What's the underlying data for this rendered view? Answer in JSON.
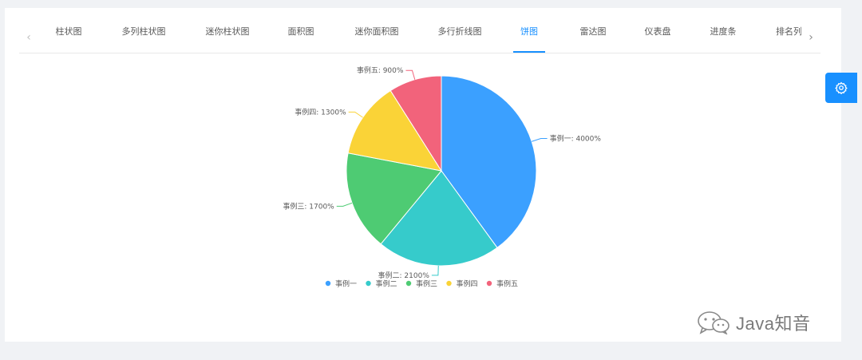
{
  "tabs": {
    "items": [
      "柱状图",
      "多列柱状图",
      "迷你柱状图",
      "面积图",
      "迷你面积图",
      "多行折线图",
      "饼图",
      "雷达图",
      "仪表盘",
      "进度条",
      "排名列"
    ],
    "active_index": 6
  },
  "settings": {
    "icon": "gear-icon"
  },
  "watermark": {
    "text": "Java知音",
    "icon": "wechat-icon"
  },
  "colors": {
    "accent": "#1890ff",
    "series": [
      "#3ba0ff",
      "#36cbcb",
      "#4ecb73",
      "#fad337",
      "#f2637b"
    ]
  },
  "chart_data": {
    "type": "pie",
    "labels": [
      "事例一",
      "事例二",
      "事例三",
      "事例四",
      "事例五"
    ],
    "values": [
      4000,
      2100,
      1700,
      1300,
      900
    ],
    "slice_labels": [
      "事例一: 4000%",
      "事例二: 2100%",
      "事例三: 1700%",
      "事例四: 1300%",
      "事例五: 900%"
    ],
    "legend": [
      "事例一",
      "事例二",
      "事例三",
      "事例四",
      "事例五"
    ],
    "legend_position": "bottom"
  }
}
